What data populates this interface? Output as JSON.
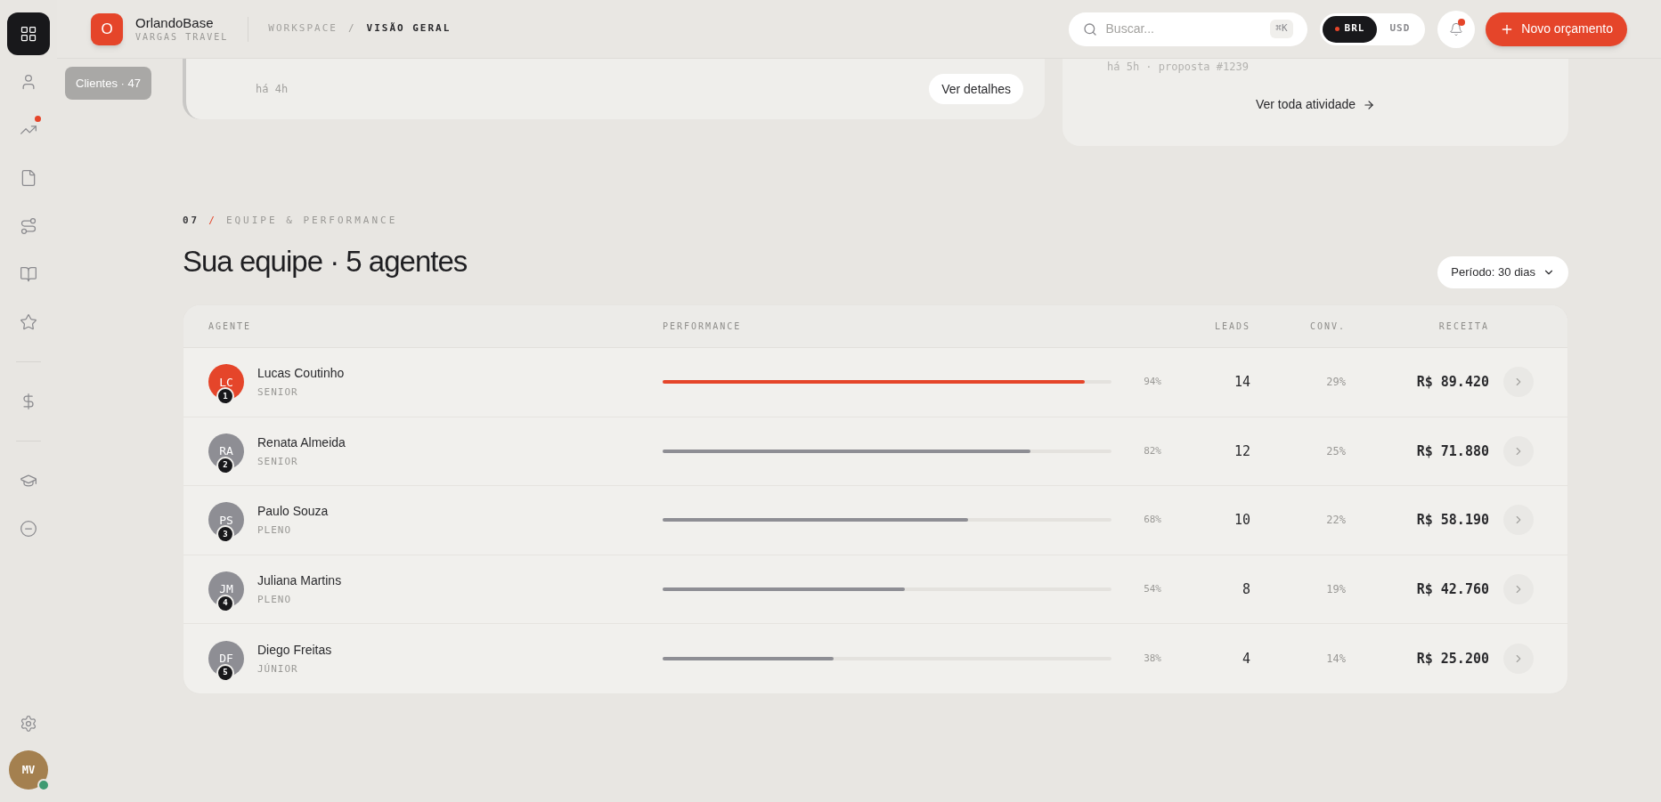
{
  "sidebar": {
    "groups": [
      {
        "items": [
          {
            "selected": true,
            "badge": false
          },
          {
            "selected": false,
            "badge": false
          },
          {
            "selected": false,
            "badge": true
          },
          {
            "selected": false,
            "badge": false
          },
          {
            "selected": false,
            "badge": false
          },
          {
            "selected": false,
            "badge": false
          },
          {
            "selected": false,
            "badge": false
          }
        ]
      },
      {
        "items": [
          {
            "selected": false,
            "badge": false
          }
        ]
      },
      {
        "items": [
          {
            "selected": false,
            "badge": false
          },
          {
            "selected": false,
            "badge": false
          }
        ]
      }
    ],
    "tooltip": "Clientes · 47",
    "user": {
      "initials": "MV",
      "online": true
    }
  },
  "header": {
    "logo": "O",
    "brand": "OrlandoBase",
    "company": "VARGAS TRAVEL",
    "breadcrumb": [
      "WORKSPACE",
      "VISÃO GERAL"
    ],
    "breadcrumb_separator": "/",
    "search": {
      "placeholder": "Buscar...",
      "shortcut": "⌘K"
    },
    "currencies": [
      {
        "label": "BRL",
        "selected": true
      },
      {
        "label": "USD",
        "selected": false
      }
    ],
    "notifications": {
      "unread": true
    },
    "new_button": "Novo orçamento"
  },
  "cards": {
    "left": {
      "time": "há 4h",
      "button": "Ver detalhes"
    },
    "right": {
      "meta": "há 5h · proposta #1239",
      "link": "Ver toda atividade"
    }
  },
  "section": {
    "number": "07",
    "separator": "/",
    "label": "EQUIPE & PERFORMANCE",
    "title": "Sua equipe · 5 agentes",
    "period": "Período: 30 dias"
  },
  "table": {
    "columns": [
      "AGENTE",
      "PERFORMANCE",
      "LEADS",
      "CONV.",
      "RECEITA"
    ],
    "rows": [
      {
        "initials": "LC",
        "rank": "1",
        "name": "Lucas Coutinho",
        "role": "SENIOR",
        "level": 0.94,
        "percent": "94%",
        "leads": "14",
        "conv": "29%",
        "revenue": "R$ 89.420",
        "color": "#e5452a"
      },
      {
        "initials": "RA",
        "rank": "2",
        "name": "Renata Almeida",
        "role": "SENIOR",
        "level": 0.82,
        "percent": "82%",
        "leads": "12",
        "conv": "25%",
        "revenue": "R$ 71.880",
        "color": "#8e8e94"
      },
      {
        "initials": "PS",
        "rank": "3",
        "name": "Paulo Souza",
        "role": "PLENO",
        "level": 0.68,
        "percent": "68%",
        "leads": "10",
        "conv": "22%",
        "revenue": "R$ 58.190",
        "color": "#8e8e94"
      },
      {
        "initials": "JM",
        "rank": "4",
        "name": "Juliana Martins",
        "role": "PLENO",
        "level": 0.54,
        "percent": "54%",
        "leads": "8",
        "conv": "19%",
        "revenue": "R$ 42.760",
        "color": "#8e8e94"
      },
      {
        "initials": "DF",
        "rank": "5",
        "name": "Diego Freitas",
        "role": "JÚNIOR",
        "level": 0.38,
        "percent": "38%",
        "leads": "4",
        "conv": "14%",
        "revenue": "R$ 25.200",
        "color": "#8e8e94"
      }
    ]
  }
}
